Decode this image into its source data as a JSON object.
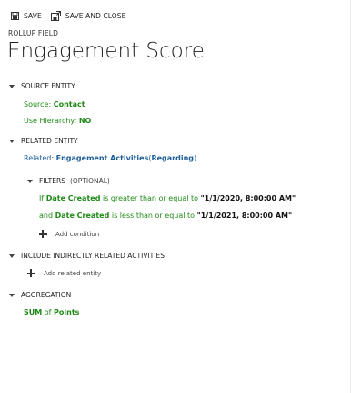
{
  "toolbar": {
    "save_label": "SAVE",
    "save_and_close_label": "SAVE AND CLOSE"
  },
  "header": {
    "rollup_label": "ROLLUP FIELD",
    "title": "Engagement Score"
  },
  "source_entity": {
    "heading": "SOURCE ENTITY",
    "source_prefix": "Source:",
    "source_value": "Contact",
    "hierarchy_prefix": "Use Hierarchy:",
    "hierarchy_value": "NO"
  },
  "related_entity": {
    "heading": "RELATED ENTITY",
    "related_prefix": "Related:",
    "related_value": "Engagement Activities",
    "paren_open": "(",
    "regarding": "Regarding",
    "paren_close": ")",
    "filters_heading": "FILTERS",
    "filters_optional": "(OPTIONAL)",
    "conditions": [
      {
        "lead": "If",
        "field": "Date Created",
        "operator": "is greater than or equal to",
        "value": "\"1/1/2020, 8:00:00 AM\""
      },
      {
        "lead": "and",
        "field": "Date Created",
        "operator": "is less than or equal to",
        "value": "\"1/1/2021, 8:00:00 AM\""
      }
    ],
    "add_condition_label": "Add condition"
  },
  "include_indirect": {
    "heading": "INCLUDE INDIRECTLY RELATED ACTIVITIES",
    "add_related_label": "Add related entity"
  },
  "aggregation": {
    "heading": "AGGREGATION",
    "function": "SUM",
    "of_word": "of",
    "field": "Points"
  },
  "colors": {
    "value_green": "#1f8a16",
    "link_blue": "#1c5c97"
  },
  "icons": {
    "save": "floppy-disk-icon",
    "save_and_close": "save-and-close-icon",
    "collapse": "caret-down-icon",
    "add": "plus-icon"
  }
}
